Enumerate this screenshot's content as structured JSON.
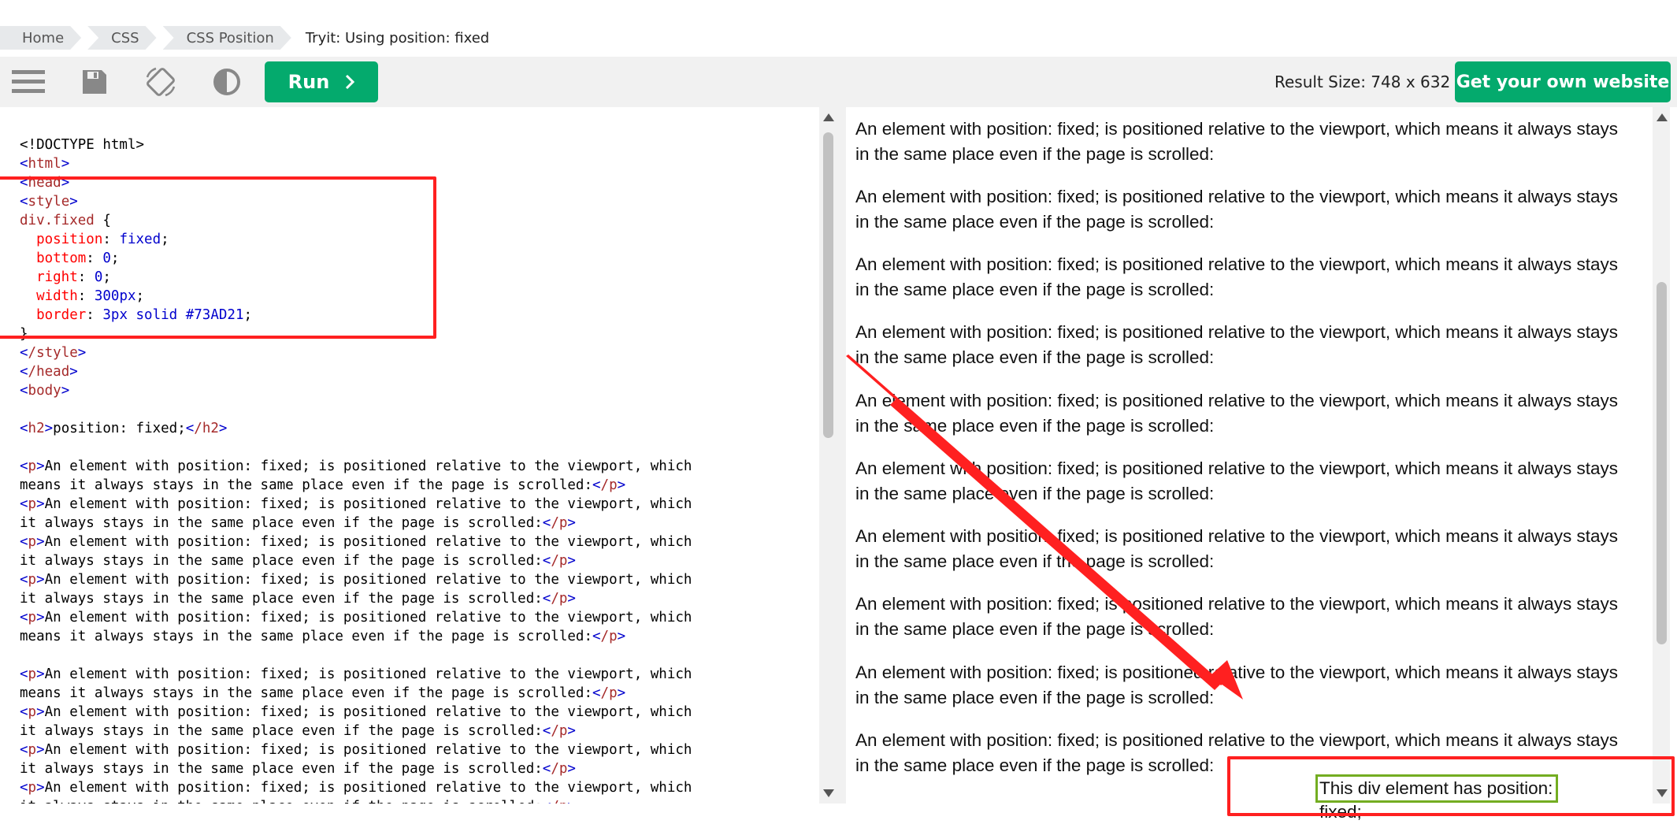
{
  "breadcrumb": {
    "items": [
      "Home",
      "CSS",
      "CSS Position"
    ],
    "current": "Tryit: Using position: fixed"
  },
  "toolbar": {
    "icons": [
      "menu-icon",
      "save-icon",
      "rotate-icon",
      "contrast-icon"
    ],
    "run_label": "Run",
    "result_size": "Result Size: 748 x 632",
    "get_website_label": "Get your own website"
  },
  "code": {
    "line_doctype": "<!DOCTYPE html>",
    "html_open": "html",
    "head_open": "head",
    "style_open": "style",
    "selector": "div.fixed",
    "declarations": [
      {
        "prop": "position",
        "val": "fixed"
      },
      {
        "prop": "bottom",
        "val": "0"
      },
      {
        "prop": "right",
        "val": "0"
      },
      {
        "prop": "width",
        "val": "300px"
      },
      {
        "prop": "border",
        "val": "3px solid #73AD21"
      }
    ],
    "style_close": "/style",
    "head_close": "/head",
    "body_open": "body",
    "h2_text": "position: fixed;",
    "p_line1": "An element with position: fixed; is positioned relative to the viewport, which",
    "p_line2a": "means it always stays in the same place even if the page is scrolled:",
    "p_line2b": "means it always stays in the same place even if the page is scrolled:",
    "p_line3": "it always stays in the same place even if the page is scrolled:"
  },
  "result": {
    "paragraph": "An element with position: fixed; is positioned relative to the viewport, which means it always stays in the same place even if the page is scrolled:",
    "fixed_text": "This div element has position: fixed;"
  },
  "colors": {
    "accent_green": "#04aa6d",
    "annotation_red": "#ff2020",
    "fixed_border": "#73ad21"
  }
}
